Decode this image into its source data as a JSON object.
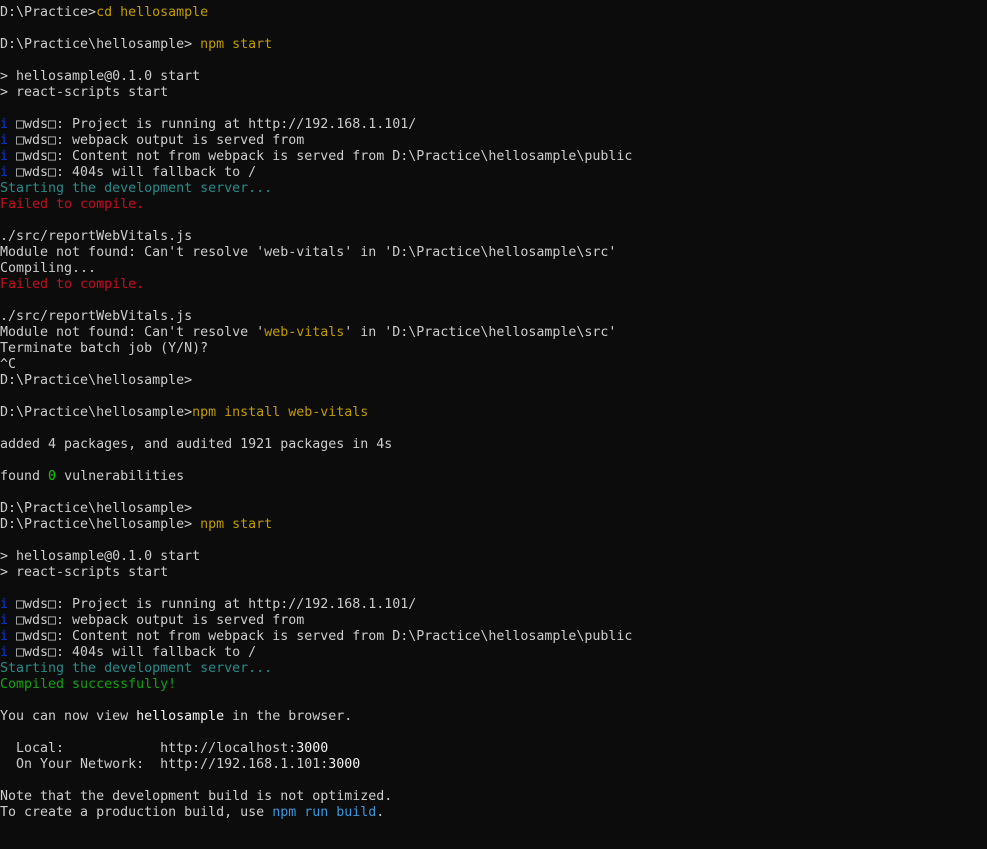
{
  "colors": {
    "background": "#0c0c0c",
    "default": "#cccccc",
    "yellow": "#c19c00",
    "red": "#c50f1f",
    "cyan": "#3a96dd",
    "teal": "#3a96dd",
    "dark_cyan": "#2a8a8a",
    "green": "#13a10e",
    "bright_green": "#16c60c",
    "blue": "#0037da",
    "white": "#f2f2f2"
  },
  "lines": [
    [
      {
        "t": "D:\\Practice>",
        "c": "default"
      },
      {
        "t": "cd hellosample",
        "c": "yellow"
      }
    ],
    [],
    [
      {
        "t": "D:\\Practice\\hellosample> ",
        "c": "default"
      },
      {
        "t": "npm start",
        "c": "yellow"
      }
    ],
    [],
    [
      {
        "t": "> hellosample@0.1.0 start",
        "c": "default"
      }
    ],
    [
      {
        "t": "> react-scripts start",
        "c": "default"
      }
    ],
    [],
    [
      {
        "t": "i ",
        "c": "blue"
      },
      {
        "t": "\u0007wds\u0007: Project is running at http://192.168.1.101/",
        "c": "default"
      }
    ],
    [
      {
        "t": "i ",
        "c": "blue"
      },
      {
        "t": "\u0007wds\u0007: webpack output is served from",
        "c": "default"
      }
    ],
    [
      {
        "t": "i ",
        "c": "blue"
      },
      {
        "t": "\u0007wds\u0007: Content not from webpack is served from D:\\Practice\\hellosample\\public",
        "c": "default"
      }
    ],
    [
      {
        "t": "i ",
        "c": "blue"
      },
      {
        "t": "\u0007wds\u0007: 404s will fallback to /",
        "c": "default"
      }
    ],
    [
      {
        "t": "Starting the development server...",
        "c": "dark_cyan"
      }
    ],
    [
      {
        "t": "Failed to compile.",
        "c": "red"
      }
    ],
    [],
    [
      {
        "t": "./src/reportWebVitals.js",
        "c": "default"
      }
    ],
    [
      {
        "t": "Module not found: Can't resolve 'web-vitals' in 'D:\\Practice\\hellosample\\src'",
        "c": "default"
      }
    ],
    [
      {
        "t": "Compiling...",
        "c": "default"
      }
    ],
    [
      {
        "t": "Failed to compile.",
        "c": "red"
      }
    ],
    [],
    [
      {
        "t": "./src/reportWebVitals.js",
        "c": "default"
      }
    ],
    [
      {
        "t": "Module not found: Can't resolve '",
        "c": "default"
      },
      {
        "t": "web-vitals",
        "c": "yellow"
      },
      {
        "t": "' in 'D:\\Practice\\hellosample\\src'",
        "c": "default"
      }
    ],
    [
      {
        "t": "Terminate batch job (Y/N)?",
        "c": "default"
      }
    ],
    [
      {
        "t": "^C",
        "c": "default"
      }
    ],
    [
      {
        "t": "D:\\Practice\\hellosample>",
        "c": "default"
      }
    ],
    [],
    [
      {
        "t": "D:\\Practice\\hellosample>",
        "c": "default"
      },
      {
        "t": "npm install web-vitals",
        "c": "yellow"
      }
    ],
    [],
    [
      {
        "t": "added 4 packages, and audited 1921 packages in 4s",
        "c": "default"
      }
    ],
    [],
    [
      {
        "t": "found ",
        "c": "default"
      },
      {
        "t": "0",
        "c": "bright_green"
      },
      {
        "t": " vulnerabilities",
        "c": "default"
      }
    ],
    [],
    [
      {
        "t": "D:\\Practice\\hellosample>",
        "c": "default"
      }
    ],
    [
      {
        "t": "D:\\Practice\\hellosample> ",
        "c": "default"
      },
      {
        "t": "npm start",
        "c": "yellow"
      }
    ],
    [],
    [
      {
        "t": "> hellosample@0.1.0 start",
        "c": "default"
      }
    ],
    [
      {
        "t": "> react-scripts start",
        "c": "default"
      }
    ],
    [],
    [
      {
        "t": "i ",
        "c": "blue"
      },
      {
        "t": "\u0007wds\u0007: Project is running at http://192.168.1.101/",
        "c": "default"
      }
    ],
    [
      {
        "t": "i ",
        "c": "blue"
      },
      {
        "t": "\u0007wds\u0007: webpack output is served from",
        "c": "default"
      }
    ],
    [
      {
        "t": "i ",
        "c": "blue"
      },
      {
        "t": "\u0007wds\u0007: Content not from webpack is served from D:\\Practice\\hellosample\\public",
        "c": "default"
      }
    ],
    [
      {
        "t": "i ",
        "c": "blue"
      },
      {
        "t": "\u0007wds\u0007: 404s will fallback to /",
        "c": "default"
      }
    ],
    [
      {
        "t": "Starting the development server...",
        "c": "dark_cyan"
      }
    ],
    [
      {
        "t": "Compiled successfully!",
        "c": "green"
      }
    ],
    [],
    [
      {
        "t": "You can now view ",
        "c": "default"
      },
      {
        "t": "hellosample",
        "c": "white"
      },
      {
        "t": " in the browser.",
        "c": "default"
      }
    ],
    [],
    [
      {
        "t": "  Local:            http://localhost:",
        "c": "default"
      },
      {
        "t": "3000",
        "c": "white"
      }
    ],
    [
      {
        "t": "  On Your Network:  http://192.168.1.101:",
        "c": "default"
      },
      {
        "t": "3000",
        "c": "white"
      }
    ],
    [],
    [
      {
        "t": "Note that the development build is not optimized.",
        "c": "default"
      }
    ],
    [
      {
        "t": "To create a production build, use ",
        "c": "default"
      },
      {
        "t": "npm run build",
        "c": "cyan"
      },
      {
        "t": ".",
        "c": "default"
      }
    ]
  ]
}
